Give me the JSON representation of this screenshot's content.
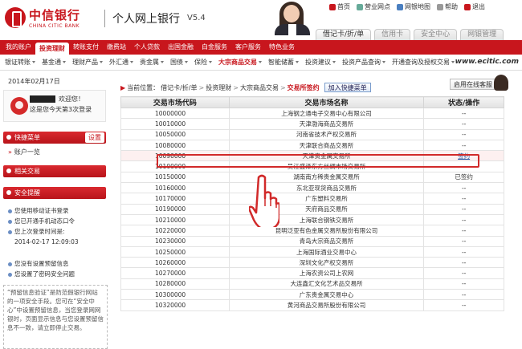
{
  "header": {
    "logo_cn": "中信银行",
    "logo_en": "CHINA CITIC BANK",
    "system_title": "个人网上银行",
    "version": "V5.4",
    "top_links": [
      "首页",
      "营业网点",
      "网银地图",
      "帮助",
      "退出"
    ],
    "card_tabs": [
      {
        "label": "借记卡/折/单",
        "active": true
      },
      {
        "label": "信用卡",
        "active": false
      },
      {
        "label": "安全中心",
        "active": false
      },
      {
        "label": "网银管理",
        "active": false
      }
    ]
  },
  "nav_primary": [
    "我的账户",
    "投资理财",
    "转账支付",
    "缴费站",
    "个人贷款",
    "出国金融",
    "白金服务",
    "客户服务",
    "特色业务"
  ],
  "nav_primary_active": 1,
  "nav_secondary": [
    "银证转账",
    "基金通",
    "理财产品",
    "外汇通",
    "贵金属",
    "国债",
    "保险",
    "大宗商品交易",
    "智能储蓄",
    "投资建议",
    "投资产品查询",
    "开通查询及授权交易"
  ],
  "nav_secondary_selected": 7,
  "site": "www.ecitic.com",
  "sidebar": {
    "date": "2014年02月17日",
    "welcome": "欢迎您！",
    "login_count": "这是您今天第3次登录",
    "quick_menu": "快捷菜单",
    "settings": "设置",
    "quick_link": "账户一览",
    "related": "相关交易",
    "security": "安全提醒",
    "sec_items": [
      "您使用移动证书登录",
      "您已开通手机动态口令",
      "您上次登录时间是:"
    ],
    "last_login": "2014-02-17 12:09:03",
    "sec_links": [
      "您没有设置预留信息",
      "您设置了密码安全问题"
    ],
    "notice": "“预留信息验证”是防范假银行网站的一项安全手段。您可在“安全中心”中设置预留信息，当您登录网网银时，页面显示信息与您设置预留信息不一致，请立即停止交易。"
  },
  "breadcrumb": {
    "prefix": "当前位置：",
    "parts": [
      "借记卡/折/单",
      "投资理财",
      "大宗商品交易"
    ],
    "current": "交易所签约",
    "add_btn": "加入快捷菜单"
  },
  "customer_service": "启用在线客服",
  "table": {
    "headers": [
      "交易市场代码",
      "交易市场名称",
      "状态/操作"
    ],
    "rows": [
      [
        "10000000",
        "上海钢之通电子交易中心有限公司",
        "--"
      ],
      [
        "10010000",
        "天津渤海商品交易所",
        "--"
      ],
      [
        "10050000",
        "河南省技术产权交易所",
        "--"
      ],
      [
        "10080000",
        "天津联合商品交易所",
        "--"
      ],
      [
        "10090000",
        "天津贵金属交易所",
        "签约"
      ],
      [
        "10100000",
        "吴江盛泽东方丝绸市场交易所",
        "--"
      ],
      [
        "10150000",
        "湖南南方稀贵金属交易所",
        "已签约"
      ],
      [
        "10160000",
        "东北亚现货商品交易所",
        "--"
      ],
      [
        "10170000",
        "广东塑料交易所",
        "--"
      ],
      [
        "10190000",
        "天府商品交易所",
        "--"
      ],
      [
        "10210000",
        "上海联合钢铁交易所",
        "--"
      ],
      [
        "10220000",
        "昆明泛亚有色金属交易所股份有限公司",
        "--"
      ],
      [
        "10230000",
        "青岛大宗商品交易所",
        "--"
      ],
      [
        "10250000",
        "上海国际酒业交易中心",
        "--"
      ],
      [
        "10260000",
        "深圳文化产权交易所",
        "--"
      ],
      [
        "10270000",
        "上海农资公司上农网",
        "--"
      ],
      [
        "10280000",
        "大连鑫汇文化艺术品交易所",
        "--"
      ],
      [
        "10300000",
        "广东贵金属交易中心",
        "--"
      ],
      [
        "10320000",
        "黄河商品交易所股份有限公司",
        "--"
      ]
    ],
    "highlight_row": 4
  },
  "colors": {
    "brand_red": "#c8161d",
    "link_blue": "#2250a0",
    "highlight_red": "#d12a2a"
  }
}
